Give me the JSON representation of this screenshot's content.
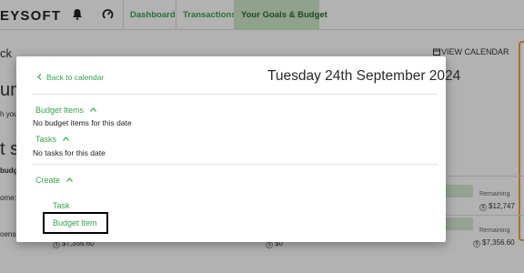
{
  "nav": {
    "brand": "EYSOFT",
    "links": [
      "Dashboard",
      "Transactions"
    ],
    "active_link": "Your Goals & Budget"
  },
  "background": {
    "back_text": "ck",
    "view_calendar": "VIEW CALENDAR",
    "heading_1": "um",
    "subtext_1": "h you",
    "heading_2": "t su",
    "subtext_2": "budg",
    "row_income_label": "ome:",
    "row_expense_label": "oense",
    "remaining_label": "Remaining",
    "remaining_1": "$12,747",
    "remaining_2": "$7,356.60",
    "amount_left_bottom": "$7,356.60",
    "amount_mid_bottom": "$0"
  },
  "modal": {
    "back_to_calendar": "Back to calendar",
    "date": "Tuesday 24th September 2024",
    "budget_items_label": "Budget Items",
    "budget_items_empty": "No budget items for this date",
    "tasks_label": "Tasks",
    "tasks_empty": "No tasks for this date",
    "create_label": "Create",
    "create_options": [
      "Task",
      "Budget Item"
    ]
  },
  "colors": {
    "accent_green": "#37a34a",
    "active_tab_bg": "#cde9c9",
    "orange_outline": "#f0a23b"
  }
}
